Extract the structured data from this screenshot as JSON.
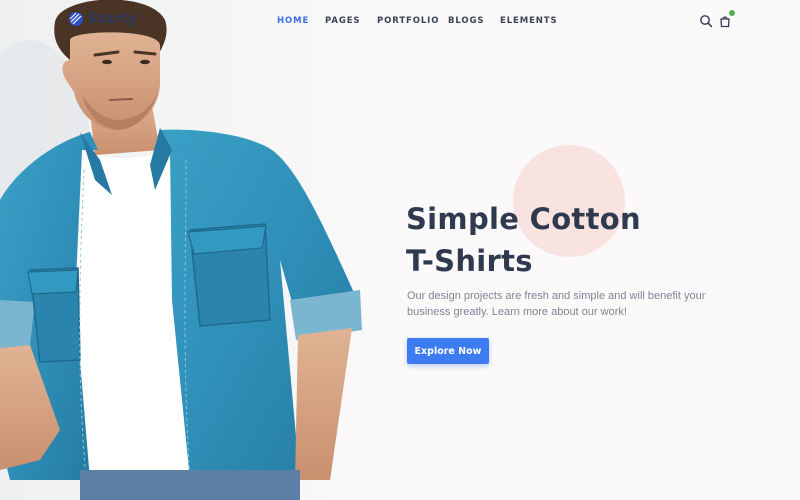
{
  "brand": {
    "name": "Starty",
    "logo_icon": "globe-stripes-icon"
  },
  "nav": {
    "items": [
      {
        "label": "HOME",
        "active": true
      },
      {
        "label": "PAGES",
        "active": false
      },
      {
        "label": "PORTFOLIO",
        "active": false
      },
      {
        "label": "BLOGS",
        "active": false
      },
      {
        "label": "ELEMENTS",
        "active": false
      }
    ]
  },
  "header_icons": {
    "search": "search-icon",
    "cart": "shopping-bag-icon"
  },
  "hero": {
    "title_line1": "Simple Cotton",
    "title_line2": "T-Shirts",
    "description": "Our design projects are fresh and simple and will benefit your business greatly. Learn more about our work!",
    "button_label": "Explore Now"
  },
  "colors": {
    "accent": "#3d7cf0",
    "heading": "#2f3a4e",
    "body_text": "#7d8595",
    "deco_circle": "#f9e3e1",
    "denim": "#2f8fb8",
    "badge": "#4caf50"
  }
}
